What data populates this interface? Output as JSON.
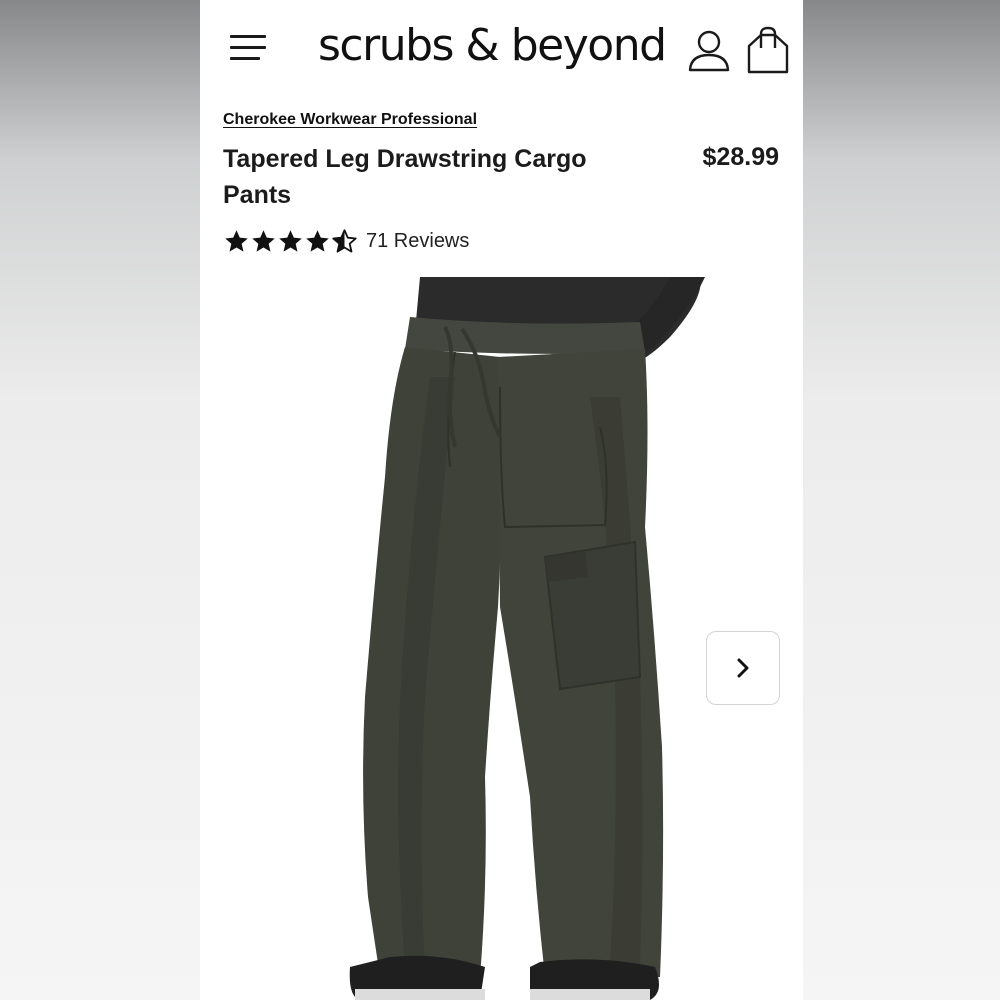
{
  "header": {
    "logo": "scrubs & beyond",
    "menu_icon": "hamburger-menu-icon",
    "account_icon": "user-account-icon",
    "bag_icon": "shopping-bag-icon"
  },
  "product": {
    "brand": "Cherokee Workwear Professional",
    "title": "Tapered Leg Drawstring Cargo Pants",
    "price": "$28.99",
    "rating": 4.5,
    "rating_max": 5,
    "reviews_label": "71 Reviews",
    "image_icon": "product-photo-pants"
  },
  "gallery": {
    "next_icon": "chevron-right-icon"
  },
  "colors": {
    "pants": "#3f4239",
    "shirt": "#2b2b2b",
    "text": "#111111"
  }
}
